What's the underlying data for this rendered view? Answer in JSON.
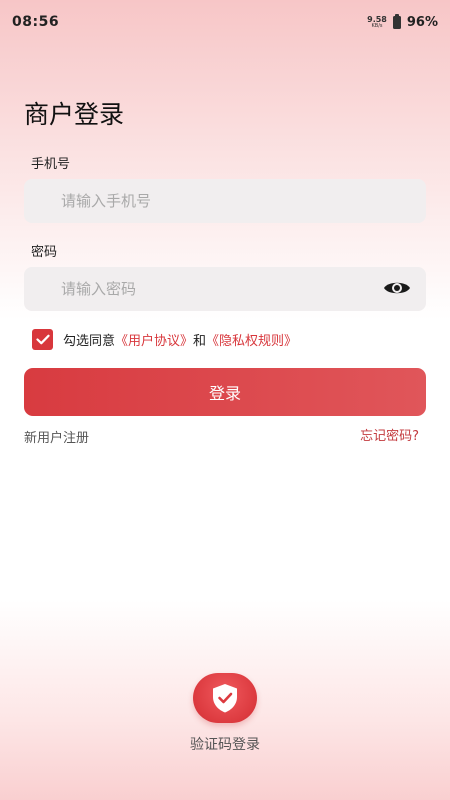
{
  "status_bar": {
    "time": "08:56",
    "net_speed_value": "9.58",
    "net_speed_unit": "KB/s",
    "battery": "96%"
  },
  "page": {
    "title": "商户登录"
  },
  "phone": {
    "label": "手机号",
    "placeholder": "请输入手机号",
    "value": ""
  },
  "password": {
    "label": "密码",
    "placeholder": "请输入密码",
    "value": "",
    "toggle_icon": "eye-icon"
  },
  "agreement": {
    "checked": true,
    "prefix": "勾选同意",
    "user_agreement": "《用户协议》",
    "conjunction": "和",
    "privacy_policy": "《隐私权规则》"
  },
  "actions": {
    "login_label": "登录",
    "register_label": "新用户注册",
    "forgot_label": "忘记密码?"
  },
  "alt_login": {
    "icon": "shield-check-icon",
    "label": "验证码登录"
  },
  "colors": {
    "accent": "#d8373c",
    "input_bg": "#f1eeef"
  }
}
